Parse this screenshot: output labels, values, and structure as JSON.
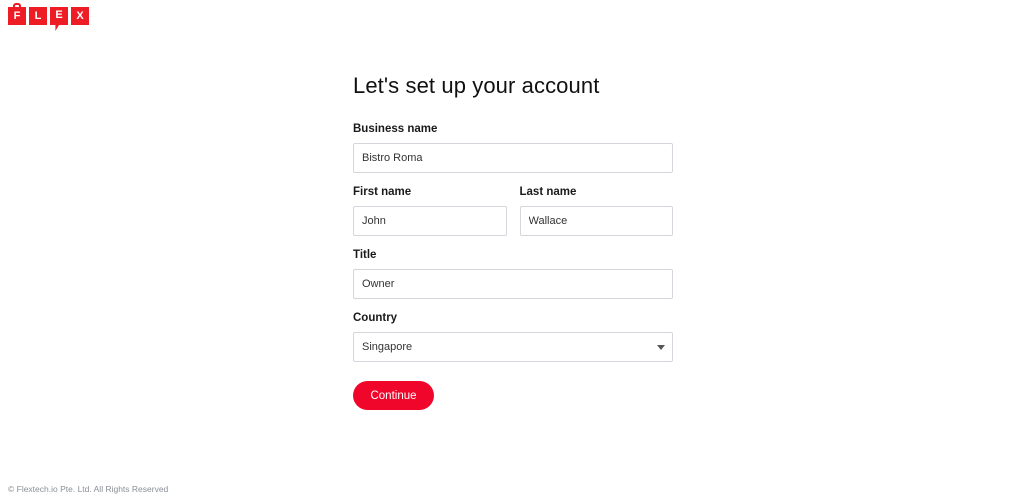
{
  "brand": {
    "letters": [
      "F",
      "L",
      "E",
      "X"
    ],
    "color": "#ee1c25"
  },
  "page": {
    "title": "Let's set up your account"
  },
  "form": {
    "business_name": {
      "label": "Business name",
      "value": "Bistro Roma"
    },
    "first_name": {
      "label": "First name",
      "value": "John"
    },
    "last_name": {
      "label": "Last name",
      "value": "Wallace"
    },
    "title": {
      "label": "Title",
      "value": "Owner"
    },
    "country": {
      "label": "Country",
      "value": "Singapore",
      "icon": "chevron-down-icon"
    },
    "continue_label": "Continue",
    "accent_color": "#f0062a"
  },
  "footer": {
    "copyright": "© Flextech.io Pte. Ltd. All Rights Reserved"
  }
}
